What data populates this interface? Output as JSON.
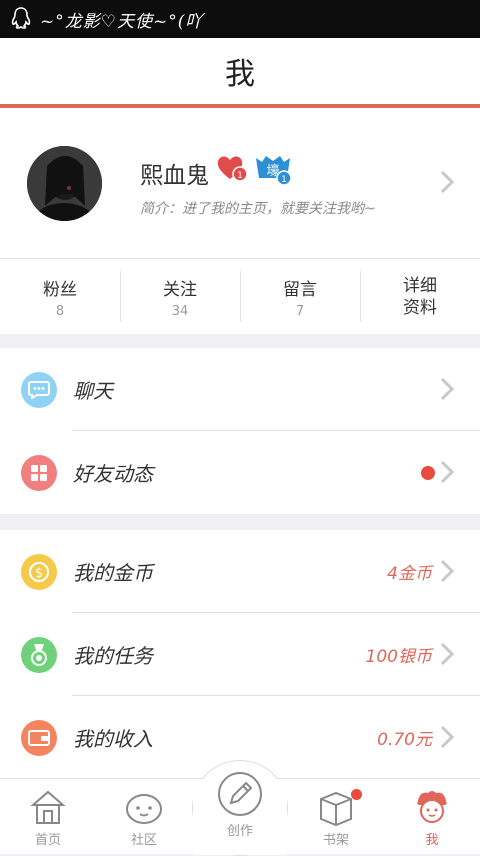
{
  "status_bar": {
    "text": "~°龙影♡天使~°(吖"
  },
  "header": {
    "title": "我"
  },
  "profile": {
    "name": "熙血鬼",
    "heart_badge_count": "1",
    "vip_badge_count": "1",
    "vip_badge_text": "壕",
    "intro": "简介：进了我的主页，就要关注我哟~"
  },
  "stats": [
    {
      "label": "粉丝",
      "value": "8"
    },
    {
      "label": "关注",
      "value": "34"
    },
    {
      "label": "留言",
      "value": "7"
    },
    {
      "label": "详细资料"
    }
  ],
  "menu_group1": [
    {
      "label": "聊天",
      "icon": "chat-icon",
      "color": "#8fd3f4"
    },
    {
      "label": "好友动态",
      "icon": "grid-icon",
      "color": "#f07f7f",
      "has_dot": true
    }
  ],
  "menu_group2": [
    {
      "label": "我的金币",
      "icon": "coin-icon",
      "color": "#f5c94a",
      "value": "4金币"
    },
    {
      "label": "我的任务",
      "icon": "medal-icon",
      "color": "#6fd17a",
      "value": "100银币"
    },
    {
      "label": "我的收入",
      "icon": "wallet-icon",
      "color": "#f4845f",
      "value": "0.70元"
    }
  ],
  "tabbar": [
    {
      "label": "首页",
      "icon": "home-icon"
    },
    {
      "label": "社区",
      "icon": "community-icon"
    },
    {
      "label": "创作",
      "icon": "pen-icon"
    },
    {
      "label": "书架",
      "icon": "bookshelf-icon"
    },
    {
      "label": "我",
      "icon": "me-icon",
      "active": true
    }
  ],
  "colors": {
    "accent": "#e0665a",
    "badge_red": "#e74c3c"
  }
}
